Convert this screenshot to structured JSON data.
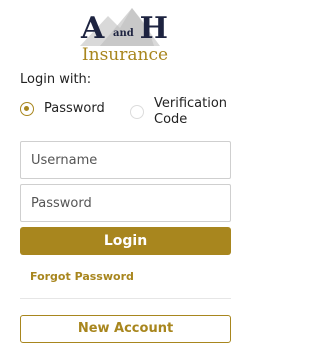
{
  "logo": {
    "initial_a": "A",
    "connector": "and",
    "initial_h": "H",
    "tagline": "Insurance"
  },
  "login": {
    "heading": "Login with:",
    "options": [
      {
        "label": "Password",
        "selected": true
      },
      {
        "label": "Verification Code",
        "line1": "Verification",
        "line2": "Code",
        "selected": false
      }
    ],
    "username_placeholder": "Username",
    "password_placeholder": "Password",
    "submit_label": "Login",
    "forgot_label": "Forgot Password",
    "new_account_label": "New Account"
  },
  "colors": {
    "accent": "#a8861e",
    "navy": "#1d2340"
  }
}
